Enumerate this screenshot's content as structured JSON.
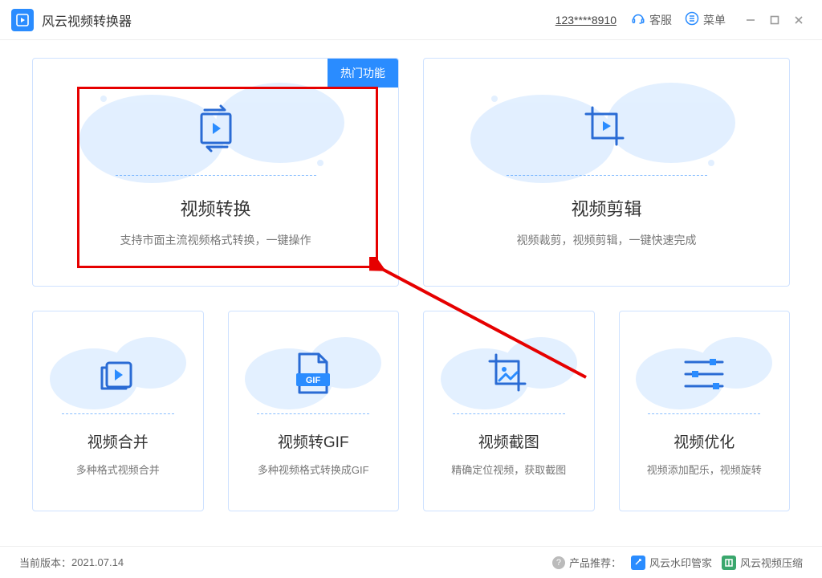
{
  "app": {
    "title": "风云视频转换器"
  },
  "titlebar": {
    "user_id": "123****8910",
    "support": "客服",
    "menu": "菜单"
  },
  "badge": "热门功能",
  "cards_big": [
    {
      "title": "视频转换",
      "desc": "支持市面主流视频格式转换，一键操作"
    },
    {
      "title": "视频剪辑",
      "desc": "视频裁剪，视频剪辑，一键快速完成"
    }
  ],
  "cards_small": [
    {
      "title": "视频合并",
      "desc": "多种格式视频合并"
    },
    {
      "title": "视频转GIF",
      "desc": "多种视频格式转换成GIF",
      "gif_label": "GIF"
    },
    {
      "title": "视频截图",
      "desc": "精确定位视频，获取截图"
    },
    {
      "title": "视频优化",
      "desc": "视频添加配乐，视频旋转"
    }
  ],
  "footer": {
    "version_label": "当前版本：",
    "version": "2021.07.14",
    "rec_label": "产品推荐：",
    "rec1": "风云水印管家",
    "rec2": "风云视频压缩"
  },
  "colors": {
    "accent": "#2a8cff"
  }
}
